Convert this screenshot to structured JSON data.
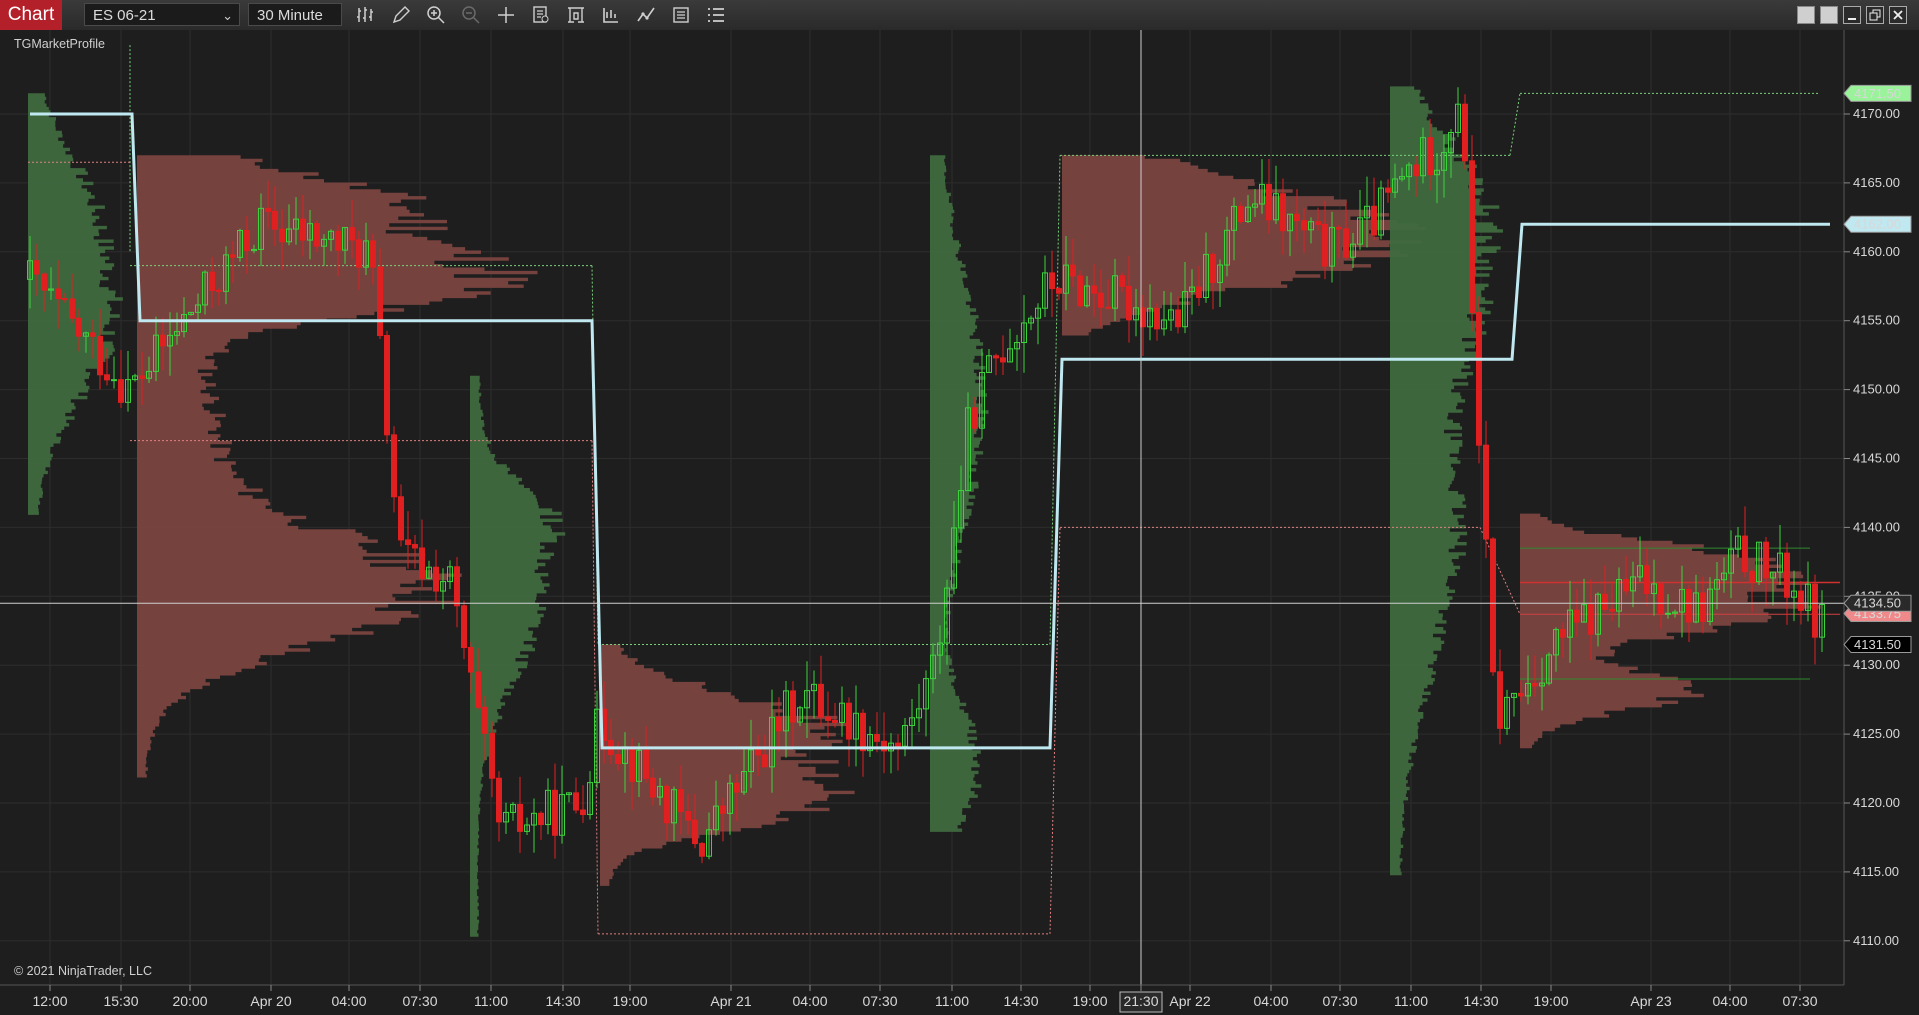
{
  "toolbar": {
    "tab_label": "Chart",
    "instrument": "ES 06-21",
    "period": "30 Minute",
    "icons": [
      "bar-type-icon",
      "pencil-icon",
      "zoom-in-icon",
      "zoom-out-icon",
      "crosshair-icon",
      "data-box-icon",
      "templates-icon",
      "strategies-icon",
      "indicators-icon",
      "properties-icon",
      "chart-trader-icon"
    ],
    "window_buttons": [
      "tile-icon",
      "tile-alt-icon",
      "minimize-icon",
      "restore-icon",
      "close-icon"
    ]
  },
  "chart": {
    "indicator_label": "TGMarketProfile",
    "copyright": "© 2021 NinjaTrader, LLC",
    "price_axis": [
      {
        "value": 4170,
        "label": "4170.00"
      },
      {
        "value": 4165,
        "label": "4165.00"
      },
      {
        "value": 4160,
        "label": "4160.00"
      },
      {
        "value": 4155,
        "label": "4155.00"
      },
      {
        "value": 4150,
        "label": "4150.00"
      },
      {
        "value": 4145,
        "label": "4145.00"
      },
      {
        "value": 4140,
        "label": "4140.00"
      },
      {
        "value": 4135,
        "label": "4135.00"
      },
      {
        "value": 4130,
        "label": "4130.00"
      },
      {
        "value": 4125,
        "label": "4125.00"
      },
      {
        "value": 4120,
        "label": "4120.00"
      },
      {
        "value": 4115,
        "label": "4115.00"
      },
      {
        "value": 4110,
        "label": "4110.00"
      }
    ],
    "time_axis": [
      "12:00",
      "15:30",
      "20:00",
      "Apr 20",
      "04:00",
      "07:30",
      "11:00",
      "14:30",
      "19:00",
      "Apr 21",
      "04:00",
      "07:30",
      "11:00",
      "14:30",
      "19:00",
      "21:30",
      "Apr 22",
      "04:00",
      "07:30",
      "11:00",
      "14:30",
      "19:00",
      "Apr 23",
      "04:00",
      "07:30"
    ],
    "crosshair_time": "21:30",
    "crosshair_price": "4134.50",
    "price_markers": [
      {
        "value": 4171.5,
        "label": "4171.50",
        "color": "#9af29a"
      },
      {
        "value": 4162.0,
        "label": "4162.00",
        "color": "#bfe8f0"
      },
      {
        "value": 4133.75,
        "label": "4133.75",
        "color": "#f08a8a"
      },
      {
        "value": 4131.5,
        "label": "4131.50",
        "color": "#000000"
      }
    ],
    "colors": {
      "background": "#1e1e1e",
      "grid": "#2d2d2d",
      "up_candle": "#3ed13e",
      "down_candle": "#e02020",
      "profile_red": "#7a4540",
      "profile_green": "#3f6a3f",
      "poc_line": "#bfe8f0"
    }
  }
}
